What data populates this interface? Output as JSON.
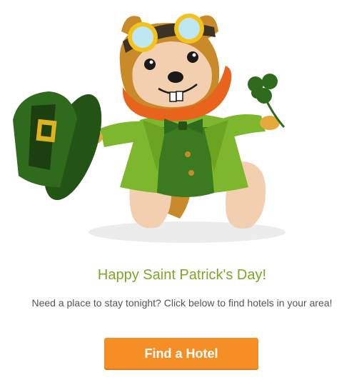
{
  "email": {
    "headline": "Happy Saint Patrick's Day!",
    "subtext": "Need a place to stay tonight? Click below to find hotels in your area!",
    "cta_label": "Find a Hotel"
  },
  "hero": {
    "illustration": "hipmunk-leprechaun-mascot",
    "icons": [
      "goggles-icon",
      "leprechaun-hat-icon",
      "shamrock-icon",
      "bow-tie-icon"
    ]
  },
  "colors": {
    "headline": "#7aa72a",
    "subtext": "#555555",
    "cta_background": "#f58f25",
    "cta_text": "#ffffff",
    "hat_green": "#2f6b1c",
    "coat_green": "#7cb72d",
    "fur_orange": "#c98a2a",
    "beard_orange": "#e8641c"
  }
}
